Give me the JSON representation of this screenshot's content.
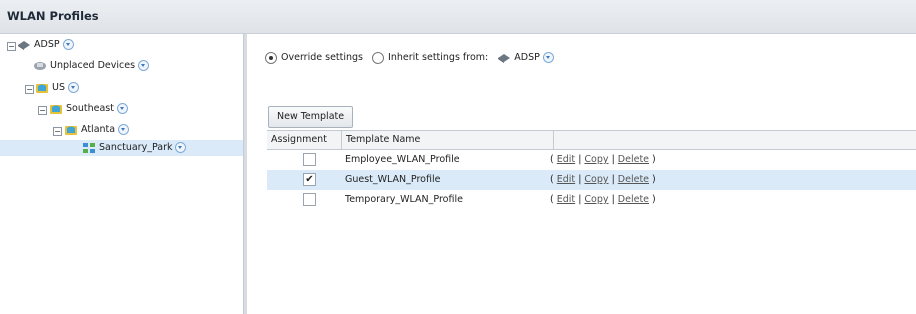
{
  "header": {
    "title": "WLAN Profiles"
  },
  "tree": {
    "root": {
      "label": "ADSP"
    },
    "unplaced": {
      "label": "Unplaced Devices"
    },
    "us": {
      "label": "US"
    },
    "southeast": {
      "label": "Southeast"
    },
    "atlanta": {
      "label": "Atlanta"
    },
    "site": {
      "label": "Sanctuary_Park"
    }
  },
  "settings": {
    "override_label": "Override settings",
    "inherit_label": "Inherit settings from:",
    "inherit_source": "ADSP",
    "selected": "override"
  },
  "toolbar": {
    "new_template_label": "New Template"
  },
  "table": {
    "headers": {
      "assignment": "Assignment",
      "template_name": "Template Name"
    },
    "action_labels": {
      "open": "(",
      "edit": "Edit",
      "sep1": "|",
      "copy": "Copy",
      "sep2": "|",
      "delete": "Delete",
      "close": ")"
    },
    "rows": [
      {
        "name": "Employee_WLAN_Profile",
        "assigned": false
      },
      {
        "name": "Guest_WLAN_Profile",
        "assigned": true
      },
      {
        "name": "Temporary_WLAN_Profile",
        "assigned": false
      }
    ]
  },
  "colors": {
    "selection": "#daeaf8",
    "header_bg": "#e4e8ec",
    "link": "#555555"
  }
}
